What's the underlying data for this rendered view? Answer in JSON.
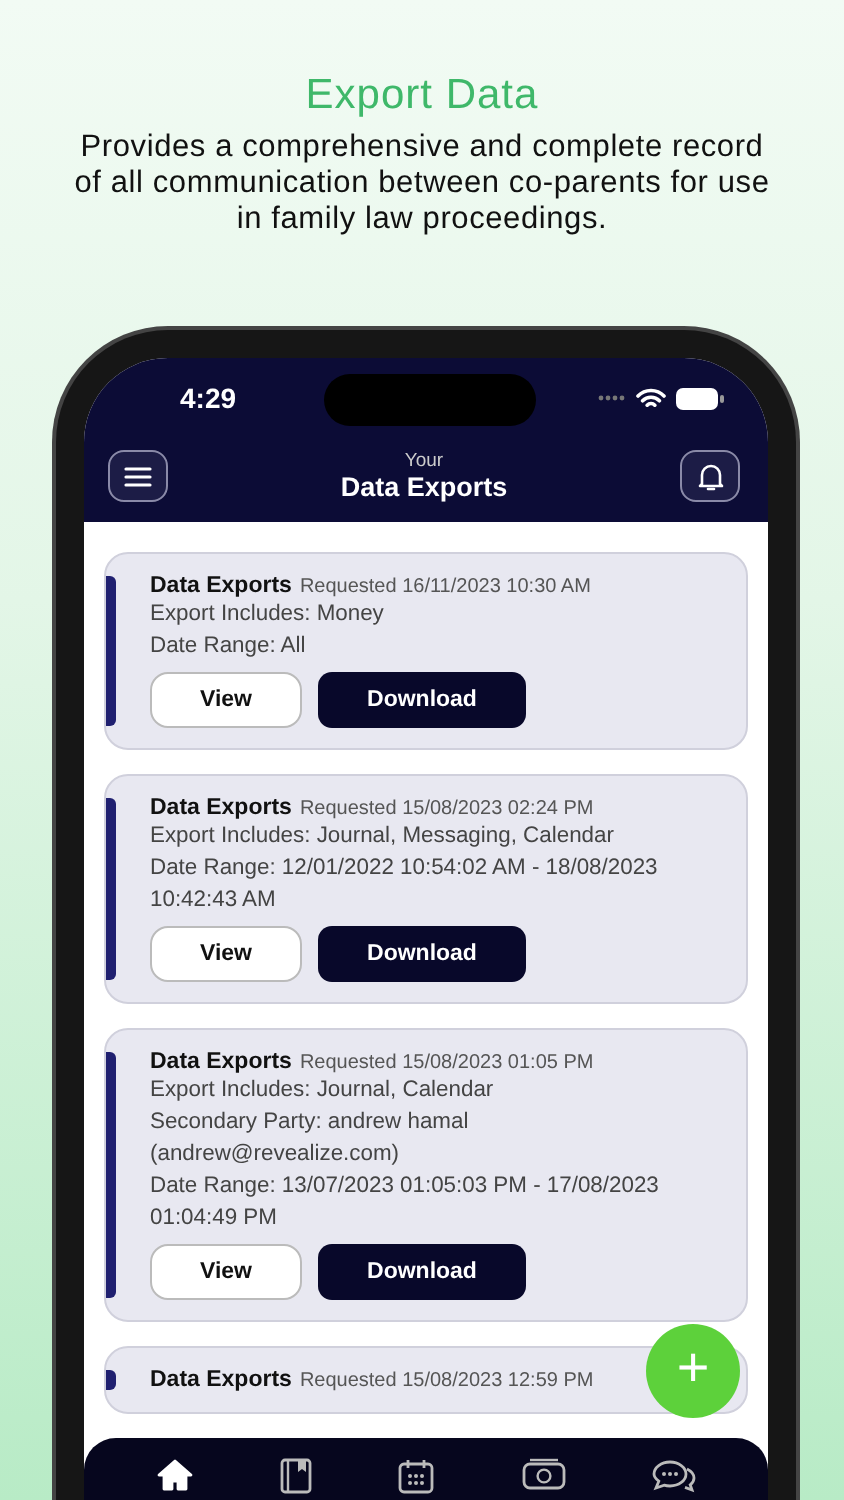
{
  "promo": {
    "title": "Export Data",
    "description": "Provides a comprehensive and complete record of all communication between co-parents for use in family law proceedings."
  },
  "status_bar": {
    "time": "4:29"
  },
  "app_bar": {
    "subtitle": "Your",
    "title": "Data Exports"
  },
  "exports": [
    {
      "title": "Data Exports",
      "requested": "Requested 16/11/2023 10:30 AM",
      "details": [
        "Export Includes: Money",
        "Date Range: All"
      ],
      "buttons": [
        "View",
        "Download"
      ]
    },
    {
      "title": "Data Exports",
      "requested": "Requested 15/08/2023 02:24 PM",
      "details": [
        "Export Includes: Journal, Messaging, Calendar",
        "Date Range: 12/01/2022 10:54:02 AM - 18/08/2023 10:42:43 AM"
      ],
      "buttons": [
        "View",
        "Download"
      ]
    },
    {
      "title": "Data Exports",
      "requested": "Requested 15/08/2023 01:05 PM",
      "details": [
        "Export Includes: Journal, Calendar",
        "Secondary Party: andrew hamal (andrew@revealize.com)",
        "Date Range: 13/07/2023 01:05:03 PM - 17/08/2023 01:04:49 PM"
      ],
      "buttons": [
        "View",
        "Download"
      ]
    },
    {
      "title": "Data Exports",
      "requested": "Requested 15/08/2023 12:59 PM"
    }
  ],
  "fab": {
    "label": "+"
  },
  "nav": [
    {
      "kind": "home",
      "selected": true
    },
    {
      "kind": "journal",
      "selected": false
    },
    {
      "kind": "calendar",
      "selected": false
    },
    {
      "kind": "money",
      "selected": false
    },
    {
      "kind": "chat",
      "selected": false
    }
  ]
}
